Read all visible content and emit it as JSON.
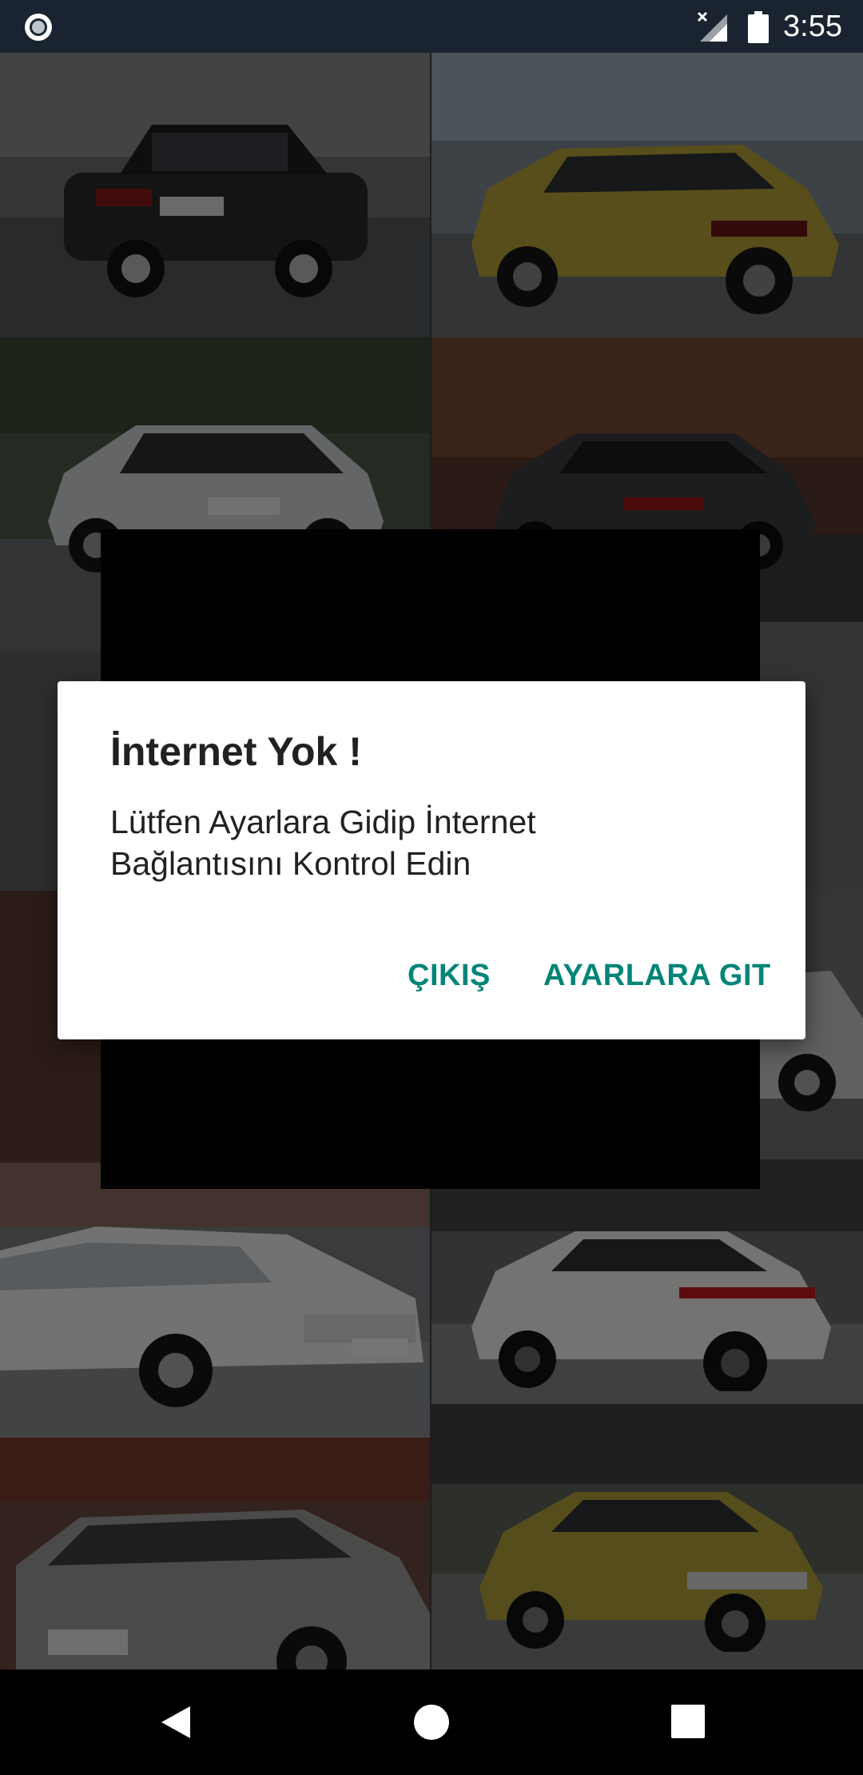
{
  "status_bar": {
    "time": "3:55",
    "icons": [
      "circle-notification-icon",
      "signal-no-data-icon",
      "battery-icon"
    ]
  },
  "dialog": {
    "title": "İnternet Yok !",
    "message": "Lütfen Ayarlara Gidip İnternet Bağlantısını Kontrol Edin",
    "exit_label": "ÇIKIŞ",
    "settings_label": "AYARLARA GIT",
    "accent_color": "#008577"
  },
  "gallery": {
    "tiles": [
      {
        "car_color": "#2a2a2a",
        "bg": "#6d6f73"
      },
      {
        "car_color": "#b9a33a",
        "bg": "#7f8a92"
      },
      {
        "car_color": "#cfd3d6",
        "bg": "#4e5a48"
      },
      {
        "car_color": "#3b3d40",
        "bg": "#5a3a2e"
      },
      {
        "car_color": "#d8d8d8",
        "bg": "#606062"
      },
      {
        "car_color": "#9a9a9a",
        "bg": "#6a6e70"
      },
      {
        "car_color": "#4a2a2a",
        "bg": "#5c3b33"
      },
      {
        "car_color": "#c9c9c9",
        "bg": "#707274"
      },
      {
        "car_color": "#efefef",
        "bg": "#7a7c7e"
      },
      {
        "car_color": "#f2f0ec",
        "bg": "#6e6a66"
      },
      {
        "car_color": "#9b9b9b",
        "bg": "#6b4a40"
      },
      {
        "car_color": "#b3a23c",
        "bg": "#5f6258"
      }
    ]
  },
  "nav_bar": {
    "icons": [
      "back-icon",
      "home-icon",
      "recents-icon"
    ]
  }
}
